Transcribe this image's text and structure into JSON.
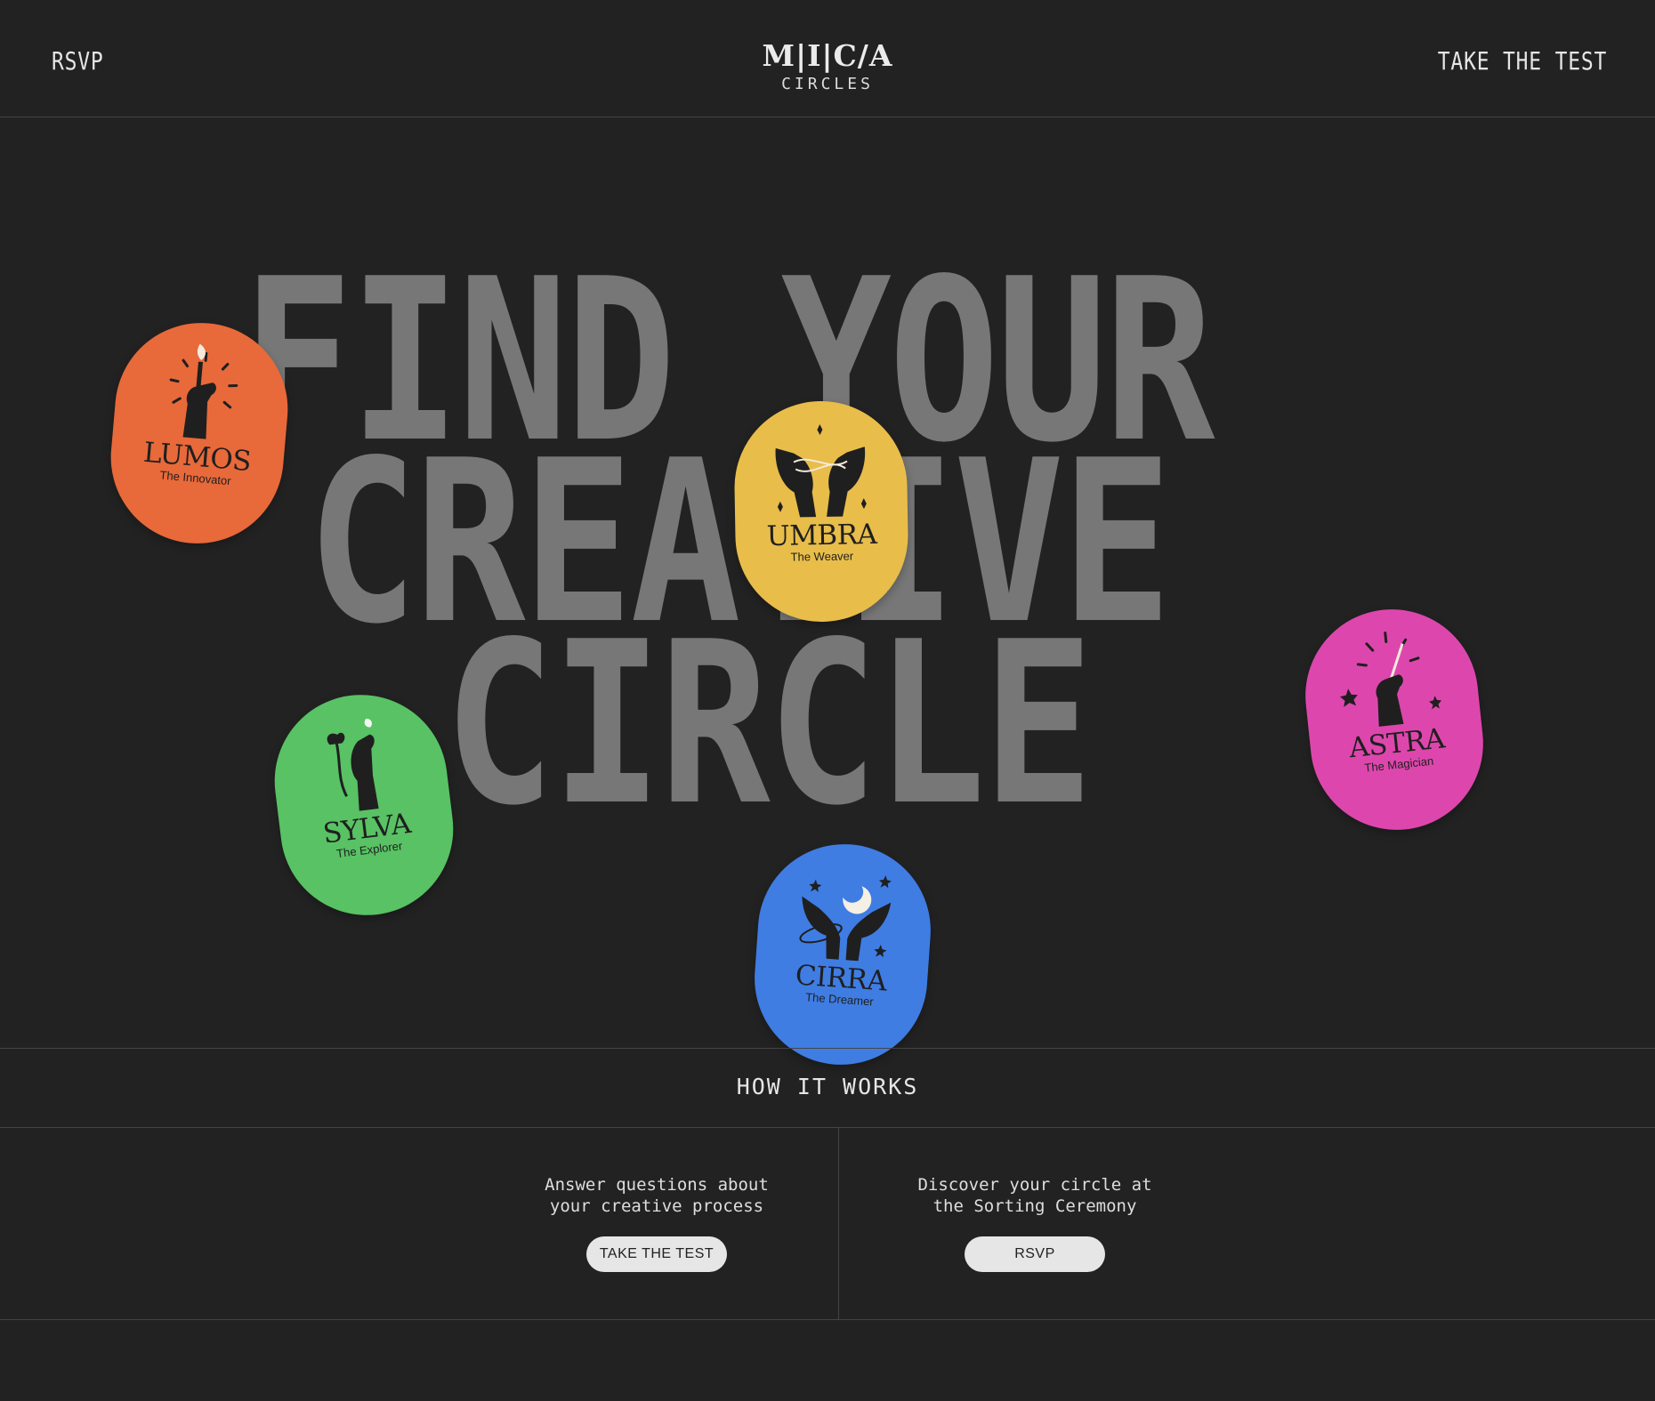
{
  "header": {
    "left_link": "RSVP",
    "logo_mark": "M|I|C/A",
    "logo_sub": "CIRCLES",
    "right_link": "TAKE THE TEST"
  },
  "hero": {
    "headline_lines": [
      "FIND YOUR",
      "CREATIVE",
      "CIRCLE"
    ]
  },
  "badges": [
    {
      "name": "LUMOS",
      "role": "The Innovator",
      "color": "#e8693a",
      "icon": "hand-holding-match-icon"
    },
    {
      "name": "UMBRA",
      "role": "The Weaver",
      "color": "#e8bd4a",
      "icon": "hands-weaving-thread-icon"
    },
    {
      "name": "ASTRA",
      "role": "The Magician",
      "color": "#dd47ad",
      "icon": "hand-holding-wand-icon"
    },
    {
      "name": "SYLVA",
      "role": "The Explorer",
      "color": "#58c264",
      "icon": "hand-with-flower-icon"
    },
    {
      "name": "CIRRA",
      "role": "The Dreamer",
      "color": "#3f7de3",
      "icon": "hands-with-moon-icon"
    }
  ],
  "how": {
    "title": "HOW IT WORKS",
    "steps": [
      {
        "text": "Answer questions about\nyour creative process",
        "button": "TAKE THE TEST"
      },
      {
        "text": "Discover your circle at\nthe Sorting Ceremony",
        "button": "RSVP"
      }
    ]
  }
}
